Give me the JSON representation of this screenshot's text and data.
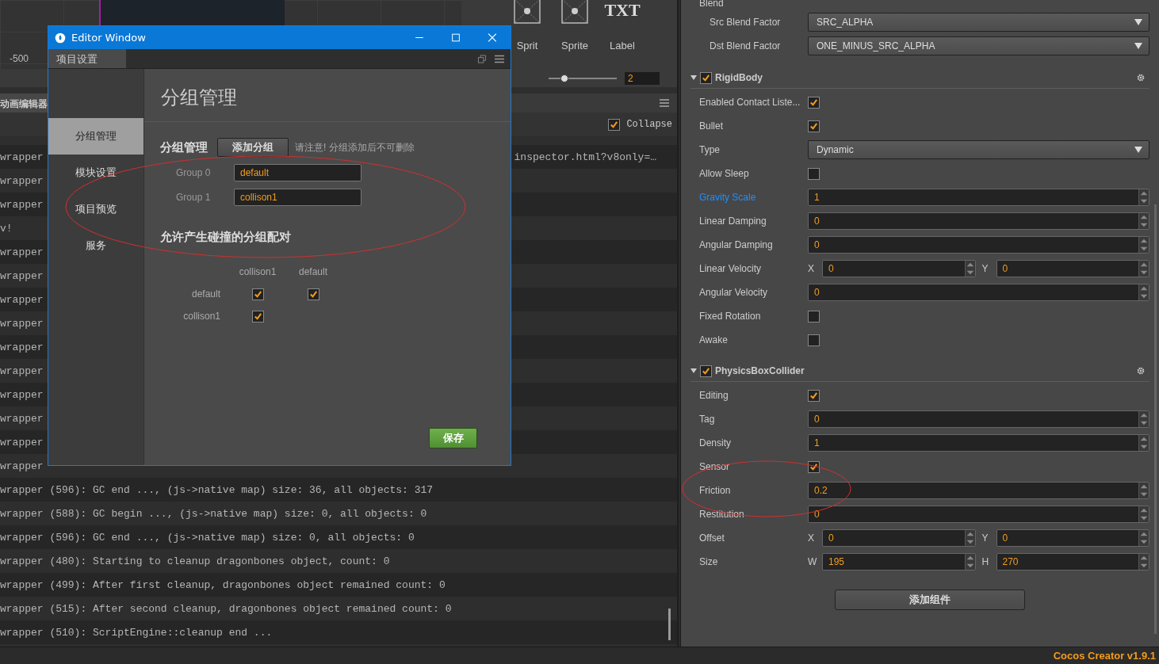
{
  "scene": {
    "axis_label": "-500"
  },
  "widgets": [
    {
      "label": "Sprit",
      "kind": "image"
    },
    {
      "label": "Sprite",
      "kind": "image"
    },
    {
      "label": "Label",
      "kind": "text",
      "glyph": "TXT"
    }
  ],
  "zoom_slider": {
    "level": 0.23,
    "value": "2"
  },
  "console": {
    "tab": "动画编辑器",
    "collapse": {
      "label": "Collapse",
      "checked": true
    },
    "lines": [
      {
        "text": "wrapper",
        "tail": "inspector.html?v8only=…"
      },
      {
        "text": "wrapper"
      },
      {
        "text": "wrapper"
      },
      {
        "text": "v!"
      },
      {
        "text": "wrapper"
      },
      {
        "text": "wrapper"
      },
      {
        "text": "wrapper"
      },
      {
        "text": "wrapper"
      },
      {
        "text": "wrapper"
      },
      {
        "text": "wrapper"
      },
      {
        "text": "wrapper"
      },
      {
        "text": "wrapper"
      },
      {
        "text": "wrapper"
      },
      {
        "text": "wrapper"
      },
      {
        "text": "wrapper (596): GC end ..., (js->native map) size: 36, all objects: 317"
      },
      {
        "text": "wrapper (588): GC begin ..., (js->native map) size: 0, all objects: 0"
      },
      {
        "text": "wrapper (596): GC end ..., (js->native map) size: 0, all objects: 0"
      },
      {
        "text": "wrapper (480): Starting to cleanup dragonbones object, count: 0"
      },
      {
        "text": "wrapper (499): After first cleanup, dragonbones object remained count: 0"
      },
      {
        "text": "wrapper (515): After second cleanup, dragonbones object remained count: 0"
      },
      {
        "text": "wrapper (510): ScriptEngine::cleanup end ..."
      }
    ]
  },
  "editor_window": {
    "title": "Editor Window",
    "tab": "项目设置",
    "nav": [
      {
        "label": "分组管理",
        "selected": true
      },
      {
        "label": "模块设置",
        "selected": false
      },
      {
        "label": "项目预览",
        "selected": false
      },
      {
        "label": "服务",
        "selected": false
      }
    ],
    "heading": "分组管理",
    "section_title": "分组管理",
    "add_button": "添加分组",
    "note": "请注意! 分组添加后不可删除",
    "groups": [
      {
        "label": "Group 0",
        "value": "default"
      },
      {
        "label": "Group 1",
        "value": "collison1"
      }
    ],
    "matrix": {
      "title": "允许产生碰撞的分组配对",
      "columns": [
        "collison1",
        "default"
      ],
      "rows": [
        {
          "label": "default",
          "checks": [
            true,
            true
          ]
        },
        {
          "label": "collison1",
          "checks": [
            true
          ]
        }
      ]
    },
    "save_button": "保存"
  },
  "inspector": {
    "blend": {
      "title": "Blend",
      "props": [
        {
          "label": "Src Blend Factor",
          "kind": "select",
          "value": "SRC_ALPHA"
        },
        {
          "label": "Dst Blend Factor",
          "kind": "select",
          "value": "ONE_MINUS_SRC_ALPHA"
        }
      ]
    },
    "components": [
      {
        "title": "RigidBody",
        "enabled": true,
        "expanded": true,
        "props": [
          {
            "label": "Enabled Contact Liste...",
            "kind": "checkbox",
            "checked": true,
            "highlighted": false
          },
          {
            "label": "Bullet",
            "kind": "checkbox",
            "checked": true,
            "highlighted": false
          },
          {
            "label": "Type",
            "kind": "select",
            "value": "Dynamic",
            "highlighted": false
          },
          {
            "label": "Allow Sleep",
            "kind": "checkbox",
            "checked": false,
            "highlighted": false
          },
          {
            "label": "Gravity Scale",
            "kind": "number",
            "value": "1",
            "highlighted": true
          },
          {
            "label": "Linear Damping",
            "kind": "number",
            "value": "0",
            "highlighted": false
          },
          {
            "label": "Angular Damping",
            "kind": "number",
            "value": "0",
            "highlighted": false
          },
          {
            "label": "Linear Velocity",
            "kind": "vec2",
            "fields": [
              {
                "axis": "X",
                "value": "0"
              },
              {
                "axis": "Y",
                "value": "0"
              }
            ],
            "highlighted": false
          },
          {
            "label": "Angular Velocity",
            "kind": "number",
            "value": "0",
            "highlighted": false
          },
          {
            "label": "Fixed Rotation",
            "kind": "checkbox",
            "checked": false,
            "highlighted": false
          },
          {
            "label": "Awake",
            "kind": "checkbox",
            "checked": false,
            "highlighted": false
          }
        ]
      },
      {
        "title": "PhysicsBoxCollider",
        "enabled": true,
        "expanded": true,
        "props": [
          {
            "label": "Editing",
            "kind": "checkbox",
            "checked": true,
            "highlighted": false
          },
          {
            "label": "Tag",
            "kind": "number",
            "value": "0",
            "highlighted": false
          },
          {
            "label": "Density",
            "kind": "number",
            "value": "1",
            "highlighted": false
          },
          {
            "label": "Sensor",
            "kind": "checkbox",
            "checked": true,
            "highlighted": false
          },
          {
            "label": "Friction",
            "kind": "number",
            "value": "0.2",
            "highlighted": false
          },
          {
            "label": "Restitution",
            "kind": "number",
            "value": "0",
            "highlighted": false
          },
          {
            "label": "Offset",
            "kind": "vec2",
            "fields": [
              {
                "axis": "X",
                "value": "0"
              },
              {
                "axis": "Y",
                "value": "0"
              }
            ],
            "highlighted": false
          },
          {
            "label": "Size",
            "kind": "vec2",
            "fields": [
              {
                "axis": "W",
                "value": "195"
              },
              {
                "axis": "H",
                "value": "270"
              }
            ],
            "highlighted": false
          }
        ]
      }
    ],
    "add_button": "添加组件"
  },
  "status_bar": {
    "version": "Cocos Creator v1.9.1"
  }
}
